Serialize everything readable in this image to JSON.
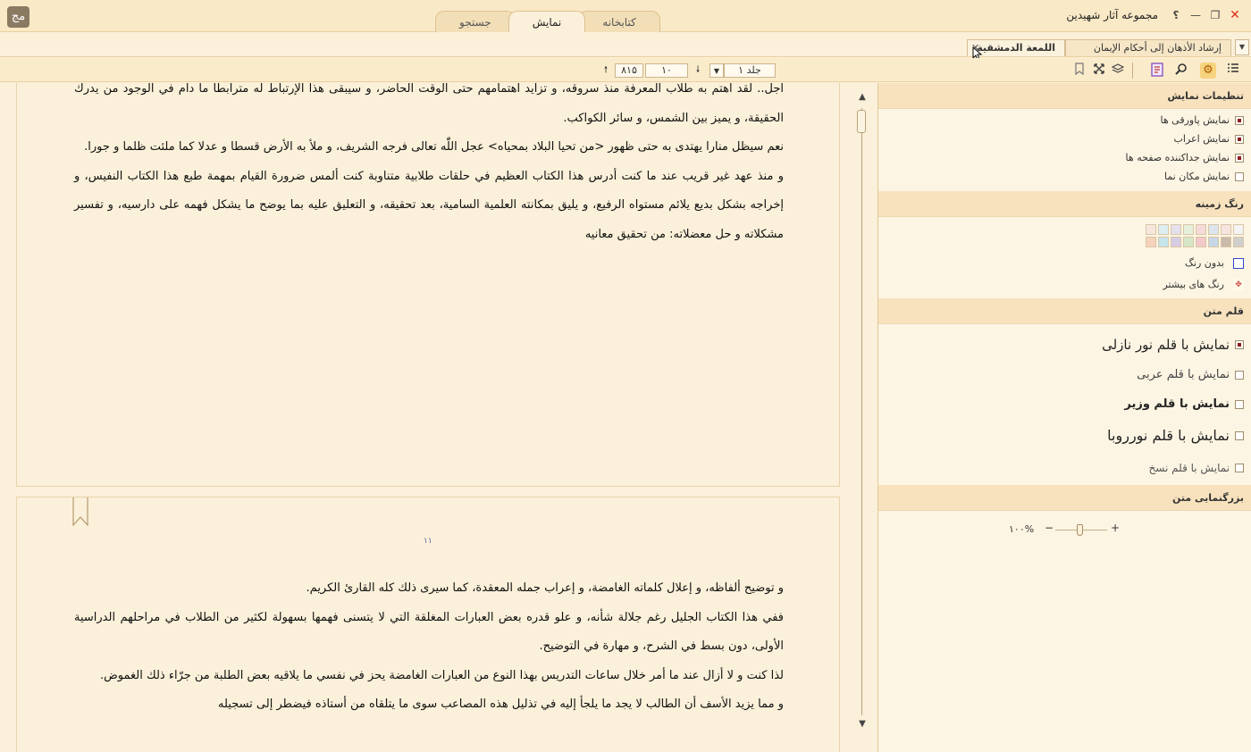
{
  "titlebar": {
    "app_title": "مجموعه آثار شهيدين",
    "logo_text": "مج",
    "help": "؟",
    "tabs": [
      {
        "label": "کتابخانه"
      },
      {
        "label": "نمایش"
      },
      {
        "label": "جستجو"
      }
    ],
    "controls": {
      "close": "✕",
      "restore": "❐",
      "minimize": "—"
    }
  },
  "book_tabs": [
    {
      "label": "إرشاد الأذهان إلى أحكام الإيمان"
    },
    {
      "label": "اللمعة الدمشقية",
      "close": "✕"
    }
  ],
  "navigation": {
    "volume": "جلد ۱",
    "page": "۱۰",
    "total_pages": "۸۱۵"
  },
  "reader": {
    "page1_paragraphs": [
      "أجل.. لقد اهتم به طلاب المعرفة منذ سروقه، و تزايد اهتمامهم حتى الوقت الحاضر، و سيبقى هذا الإرتباط له مترابطا ما دام في الوجود من يدرك الحقيقة، و يميز بين الشمس، و سائر الكواكب.",
      "نعم سيظل منارا يهتدى به حتى ظهور <من تحيا البلاد بمحياه> عجل اللّٰه تعالى فرجه الشريف، و ملأ به الأرض قسطا و عدلا كما ملئت ظلما و جورا.",
      "و منذ عهد غير قريب عند ما كنت أدرس هذا الكتاب العظيم في حلقات طلابية متناوبة كنت ألمس ضرورة القيام بمهمة طبع هذا الكتاب النفيس، و إخراجه بشكل بديع يلائم مستواه الرفيع، و يليق بمكانته العلمية السامية، بعد تحقيقه، و التعليق عليه بما يوضح ما يشكل فهمه على دارسيه، و تفسير مشكلاته و حل معضلاته: من تحقيق معانيه"
    ],
    "page2_number": "۱۱",
    "page2_paragraphs": [
      "و توضيح ألفاظه، و إعلال كلماته الغامضة، و إعراب جمله المعقدة، كما سيرى ذلك كله القارئ الكريم.",
      "ففي هذا الكتاب الجليل رغم جلالة شأنه، و علو قدره بعض العبارات المغلقة التي لا يتسنى فهمها بسهولة لكثير من الطلاب في مراحلهم الدراسية الأولى، دون بسط في الشرح، و مهارة في التوضيح.",
      "لذا كنت و لا أزال عند ما أمر خلال ساعات التدريس بهذا النوع من العبارات الغامضة يحز في نفسي ما يلاقيه بعض الطلبة من جرّاء ذلك الغموض.",
      "و مما يزيد الأسف أن الطالب لا يجد ما يلجأ إليه في تذليل هذه المصاعب سوى ما يتلقاه من أستاذه فيضطر إلى تسجيله"
    ]
  },
  "panel": {
    "display_settings": {
      "title": "تنظیمات نمایش",
      "options": [
        {
          "label": "نمایش پاورقی ها",
          "checked": true
        },
        {
          "label": "نمایش اعراب",
          "checked": true
        },
        {
          "label": "نمایش جداکننده صفحه ها",
          "checked": true
        },
        {
          "label": "نمایش مکان نما",
          "checked": false
        }
      ]
    },
    "background_color": {
      "title": "رنگ زمینه",
      "swatches": [
        [
          "#f3f3f3",
          "#cfcfcf"
        ],
        [
          "#f6e4e0",
          "#c9b9ab"
        ],
        [
          "#dce6ee",
          "#c6d8e6"
        ],
        [
          "#f6dada",
          "#f2c8c8"
        ],
        [
          "#e6f0dc",
          "#d6e6c6"
        ],
        [
          "#e6e0ee",
          "#d6cce4"
        ],
        [
          "#dceef2",
          "#c6e4ec"
        ],
        [
          "#f6e6dc",
          "#f6d2bc"
        ]
      ],
      "no_color": "بدون رنگ",
      "more_colors": "رنگ های بیشتر"
    },
    "text_font": {
      "title": "قلم متن",
      "options": [
        {
          "label": "نمایش با قلم نور نازلی",
          "checked": true
        },
        {
          "label": "نمایش با قلم عربی",
          "checked": false
        },
        {
          "label": "نمایش با قلم وزیر",
          "checked": false
        },
        {
          "label": "نمایش با قلم نورروبا",
          "checked": false
        },
        {
          "label": "نمایش با قلم نسخ",
          "checked": false
        }
      ]
    },
    "zoom": {
      "title": "بزرگنمایی متن",
      "value": "۱۰۰%",
      "minus": "−",
      "plus": "+"
    }
  }
}
